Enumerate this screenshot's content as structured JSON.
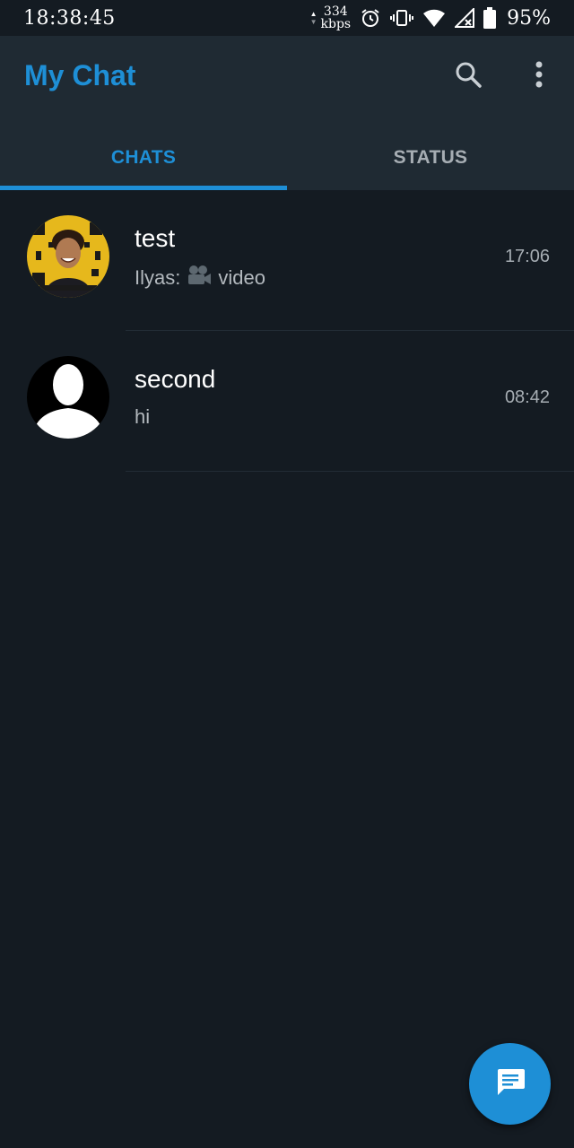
{
  "status_bar": {
    "time": "18:38:45",
    "net_speed_value": "334",
    "net_speed_unit": "kbps",
    "battery_percent": "95%"
  },
  "app_bar": {
    "title": "My Chat",
    "title_color": "#1e8fd6",
    "search_icon": "search-icon",
    "more_icon": "more-vert-icon"
  },
  "tabs": [
    {
      "label": "CHATS",
      "active": true
    },
    {
      "label": "STATUS",
      "active": false
    }
  ],
  "chats": [
    {
      "name": "test",
      "preview_sender": "Ilyas:",
      "preview_icon": "video-camera-icon",
      "preview_text": "video",
      "time": "17:06",
      "avatar": "profile-photo"
    },
    {
      "name": "second",
      "preview_sender": "",
      "preview_text": "hi",
      "time": "08:42",
      "avatar": "default-person-avatar"
    }
  ],
  "fab": {
    "icon": "message-icon",
    "color": "#1e8fd6"
  }
}
